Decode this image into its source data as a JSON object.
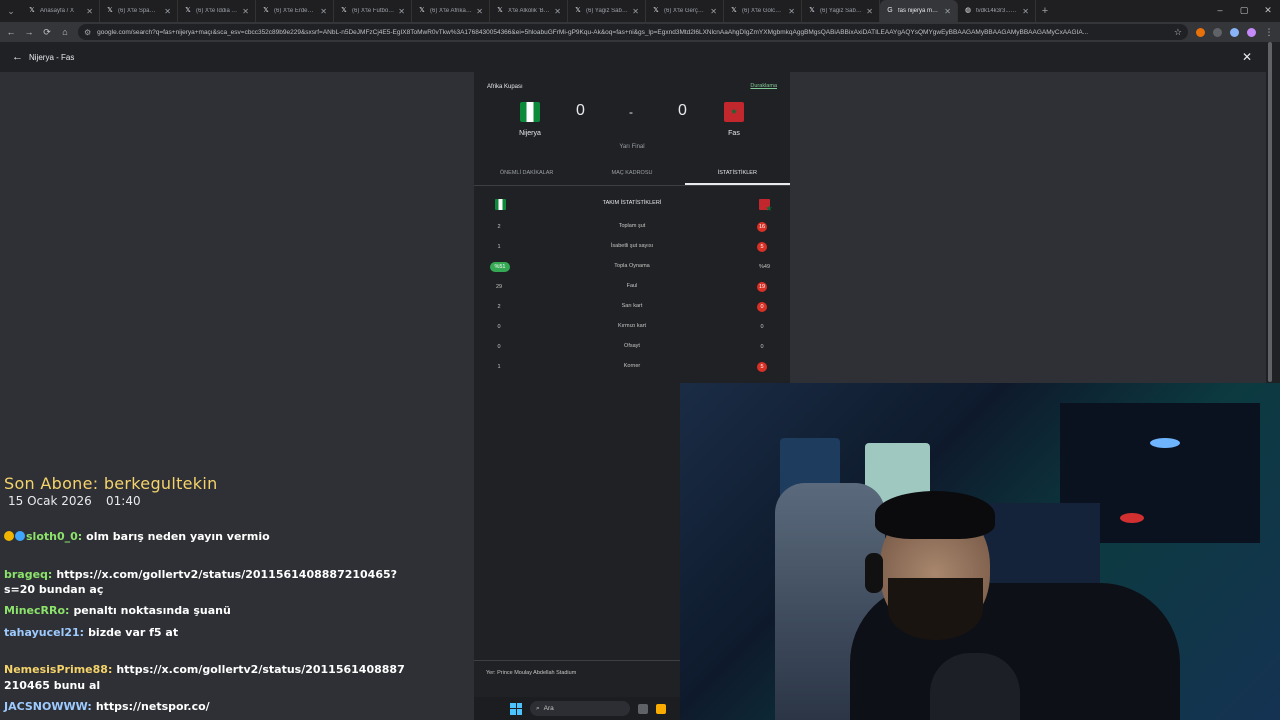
{
  "browser": {
    "tabs": [
      {
        "label": "Anasayfa / X",
        "icon": "x-logo-icon",
        "active": false
      },
      {
        "label": "(6) X'te Spamc Tim...",
        "icon": "x-logo-icon",
        "active": false
      },
      {
        "label": "(6) X'te Iddia Anlat...",
        "icon": "x-logo-icon",
        "active": false
      },
      {
        "label": "(6) X'te Erdem Akku...",
        "icon": "x-logo-icon",
        "active": false
      },
      {
        "label": "(6) X'te Futbol do Bra...",
        "icon": "x-logo-icon",
        "active": false
      },
      {
        "label": "(6) X'te Afrika Futbo...",
        "icon": "x-logo-icon",
        "active": false
      },
      {
        "label": "X'te Alkolik 'Bir...",
        "icon": "x-logo-icon",
        "active": false
      },
      {
        "label": "(6) Yagiz Sabuncuo...",
        "icon": "x-logo-icon",
        "active": false
      },
      {
        "label": "(6) X'te Gerçek Arch...",
        "icon": "x-logo-icon",
        "active": false
      },
      {
        "label": "(6) X'te Golcern Cup...",
        "icon": "x-logo-icon",
        "active": false
      },
      {
        "label": "(6) Yagiz Sabuncuo...",
        "icon": "x-logo-icon",
        "active": false
      },
      {
        "label": "fas nijerya maçı - G...",
        "icon": "google-icon",
        "active": true
      },
      {
        "label": "tvdk14k3r3...1666...",
        "icon": "globe-icon",
        "active": false
      }
    ],
    "url": "google.com/search?q=fas+nijerya+maçı&sca_esv=cbcc352c89b9e229&sxsrf=ANbL-n5DeJMFzCj4E5-EgIX8ToMwR0vTkw%3A1768430054366&ei=5hloabuGFrMi-gP9Kqu-Ak&oq=fas+ni&gs_lp=Egxnd3Mtd2l6LXNlcnAaAhgDIgZmYXMgbmkqAggBMgsQABiABBixAxiDATILEAAYgAQYsQMYgwEyBBAAGAMyBBAAGAMyBBAAGAMyCxAAGIA...",
    "window_controls": {
      "minimize": "–",
      "maximize": "▢",
      "close": "✕"
    }
  },
  "page": {
    "title": "Nijerya - Fas"
  },
  "match": {
    "competition": "Afrika Kupası",
    "follow_label": "Duraklama",
    "home": {
      "name": "Nijerya",
      "score": "0"
    },
    "away": {
      "name": "Fas",
      "score": "0"
    },
    "separator": "-",
    "stage": "Yarı Final",
    "tabs": [
      {
        "label": "ÖNEMLİ DAKİKALAR",
        "active": false
      },
      {
        "label": "MAÇ KADROSU",
        "active": false
      },
      {
        "label": "İSTATİSTİKLER",
        "active": true
      }
    ],
    "stats_title": "TAKIM İSTATİSTİKLERİ",
    "stats": [
      {
        "label": "Toplam şut",
        "home": "2",
        "away": "16",
        "highlight": "away"
      },
      {
        "label": "İsabetli şut sayısı",
        "home": "1",
        "away": "5",
        "highlight": "away"
      },
      {
        "label": "Topla Oynama",
        "home": "%51",
        "away": "%49",
        "highlight": "home"
      },
      {
        "label": "Faul",
        "home": "29",
        "away": "19",
        "highlight": "away"
      },
      {
        "label": "Sarı kart",
        "home": "2",
        "away": "0",
        "highlight": "away"
      },
      {
        "label": "Kırmızı kart",
        "home": "0",
        "away": "0",
        "highlight": "none"
      },
      {
        "label": "Ofsayt",
        "home": "0",
        "away": "0",
        "highlight": "none"
      },
      {
        "label": "Korner",
        "home": "1",
        "away": "5",
        "highlight": "away"
      }
    ],
    "venue": "Yer: Prince Moulay Abdellah Stadium"
  },
  "overlay": {
    "last_sub_label": "Son Abone: berkegultekin",
    "date": "15 Ocak 2026",
    "time": "01:40"
  },
  "chat": [
    {
      "user": "sloth0_0:",
      "message": "olm barış neden yayın vermio",
      "user_color": "#8ce36b"
    },
    {
      "user": "brageq:",
      "message": "https://x.com/gollertv2/status/2011561408887210465?",
      "user_color": "#8ce36b"
    },
    {
      "user": "",
      "message": "s=20 bundan aç",
      "user_color": "#8ce36b"
    },
    {
      "user": "MinecRRo:",
      "message": "penaltı noktasında şuanü",
      "user_color": "#8ce36b"
    },
    {
      "user": "tahayucel21:",
      "message": "bizde var f5 at",
      "user_color": "#9ecbff"
    },
    {
      "user": "NemesisPrime88:",
      "message": "https://x.com/gollertv2/status/2011561408887",
      "user_color": "#f5d36b"
    },
    {
      "user": "",
      "message": "210465 bunu al",
      "user_color": "#f5d36b"
    },
    {
      "user": "JACSNOWWW:",
      "message": "https://netspor.co/",
      "user_color": "#9ecbff"
    }
  ],
  "taskbar": {
    "search_placeholder": "Ara"
  },
  "colors": {
    "accent_green": "#81c995",
    "stat_red": "#d93025",
    "stat_green": "#34a853",
    "sub_gold": "#f5d36b"
  }
}
